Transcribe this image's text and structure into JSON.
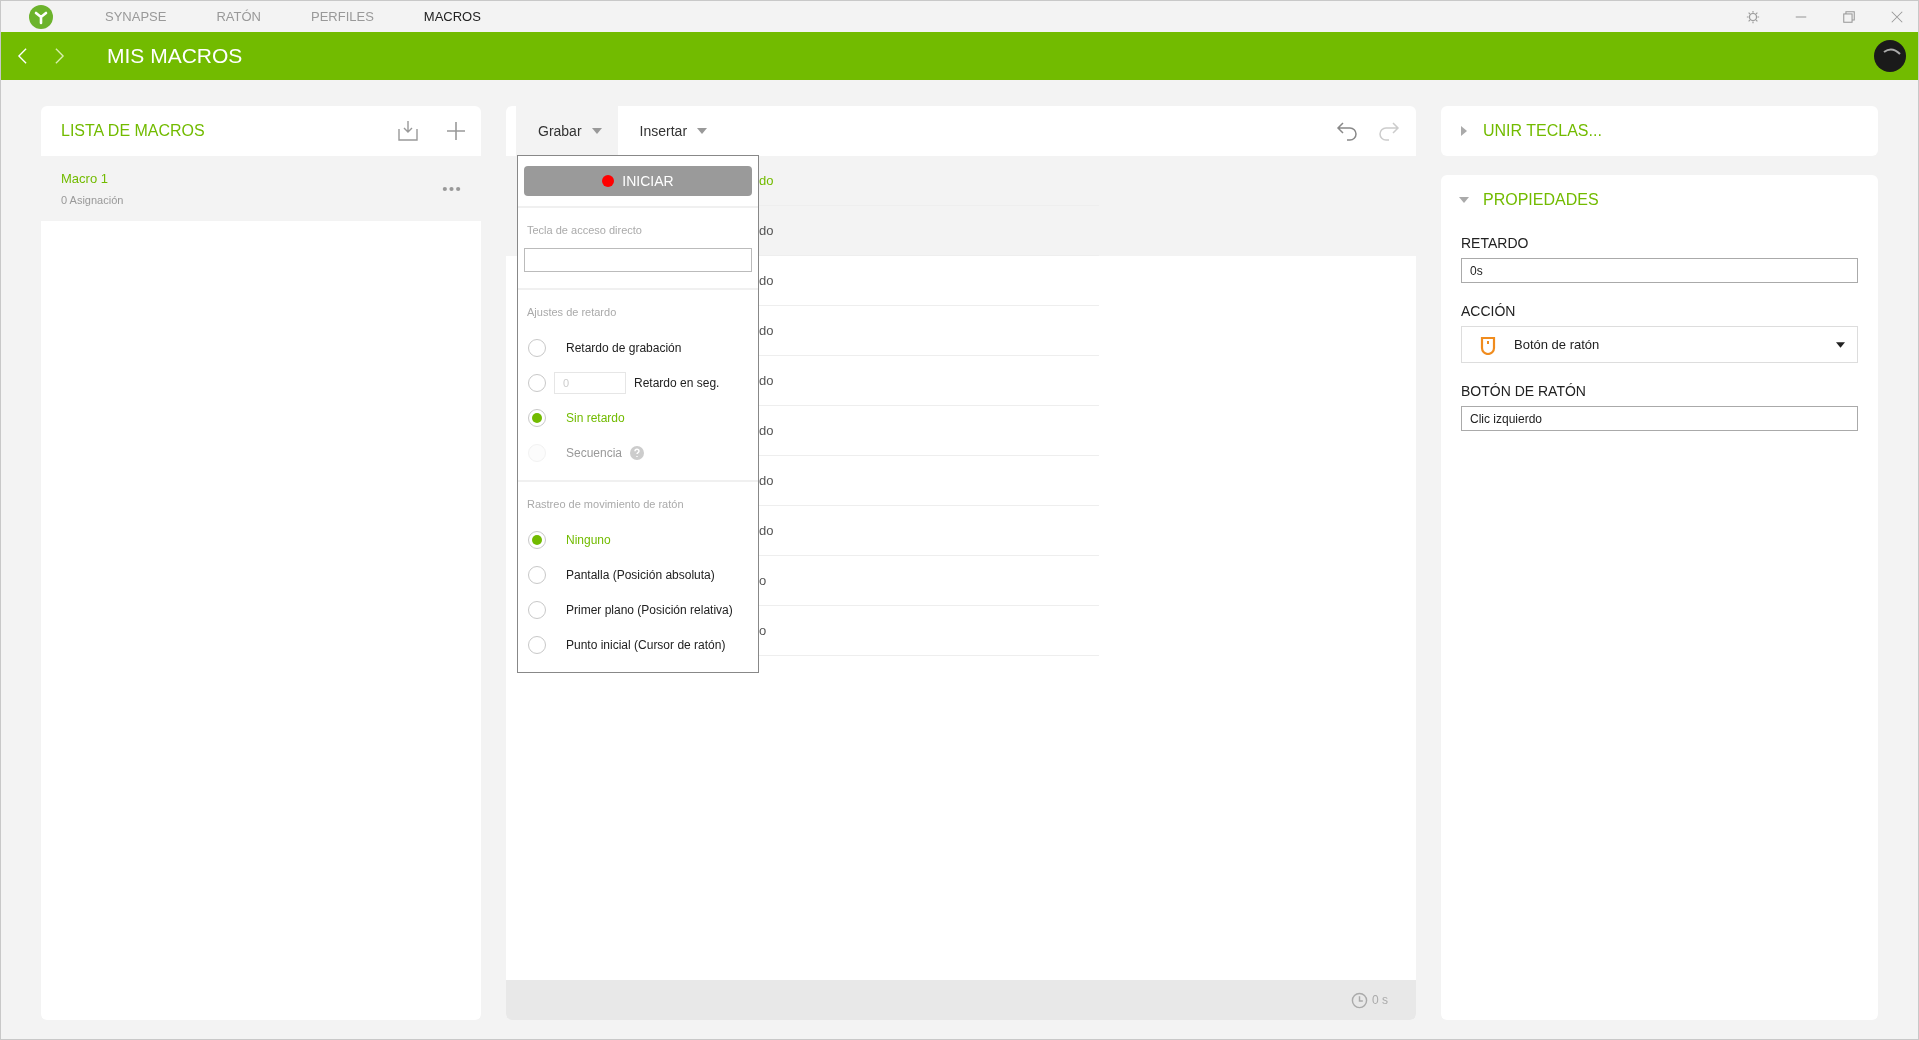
{
  "nav": {
    "tabs": [
      {
        "label": "SYNAPSE",
        "selected": false
      },
      {
        "label": "RATÓN",
        "selected": false
      },
      {
        "label": "PERFILES",
        "selected": false
      },
      {
        "label": "MACROS",
        "selected": true
      }
    ]
  },
  "header": {
    "title": "MIS MACROS"
  },
  "macro_list": {
    "title": "LISTA DE MACROS",
    "items": [
      {
        "name": "Macro 1",
        "sub": "0 Asignación",
        "selected": true
      }
    ]
  },
  "editor": {
    "tabs": [
      {
        "label": "Grabar",
        "selected": true
      },
      {
        "label": "Insertar",
        "selected": false
      }
    ],
    "rows": [
      {
        "text": "do",
        "selected": true,
        "hovered": false
      },
      {
        "text": "do",
        "selected": false,
        "hovered": true
      },
      {
        "text": "do",
        "selected": false,
        "hovered": false
      },
      {
        "text": "do",
        "selected": false,
        "hovered": false
      },
      {
        "text": "do",
        "selected": false,
        "hovered": false
      },
      {
        "text": "do",
        "selected": false,
        "hovered": false
      },
      {
        "text": "do",
        "selected": false,
        "hovered": false
      },
      {
        "text": "do",
        "selected": false,
        "hovered": false
      },
      {
        "text": "o",
        "selected": false,
        "hovered": false
      },
      {
        "text": "o",
        "selected": false,
        "hovered": false
      }
    ],
    "duration": "0 s"
  },
  "record_menu": {
    "start": "INICIAR",
    "hotkey_label": "Tecla de acceso directo",
    "delay_label": "Ajustes de retardo",
    "delay_options": [
      {
        "kind": "radio",
        "label": "Retardo de grabación",
        "selected": false,
        "disabled": false
      },
      {
        "kind": "input",
        "label": "Retardo en seg.",
        "placeholder": "0",
        "selected": false,
        "disabled": false
      },
      {
        "kind": "radio",
        "label": "Sin retardo",
        "selected": true,
        "disabled": false
      },
      {
        "kind": "help",
        "label": "Secuencia",
        "selected": false,
        "disabled": true
      }
    ],
    "tracking_label": "Rastreo de movimiento de ratón",
    "tracking_options": [
      {
        "label": "Ninguno",
        "selected": true
      },
      {
        "label": "Pantalla (Posición absoluta)",
        "selected": false
      },
      {
        "label": "Primer plano (Posición relativa)",
        "selected": false
      },
      {
        "label": "Punto inicial (Cursor de ratón)",
        "selected": false
      }
    ]
  },
  "panels": {
    "join_keys": {
      "title": "UNIR TECLAS...",
      "expanded": false
    },
    "properties": {
      "title": "PROPIEDADES",
      "expanded": true,
      "fields": [
        {
          "label": "RETARDO",
          "kind": "text",
          "value": "0s"
        },
        {
          "label": "ACCIÓN",
          "kind": "select",
          "value": "Botón de ratón"
        },
        {
          "label": "BOTÓN DE RATÓN",
          "kind": "text",
          "value": "Clic izquierdo"
        }
      ]
    }
  }
}
